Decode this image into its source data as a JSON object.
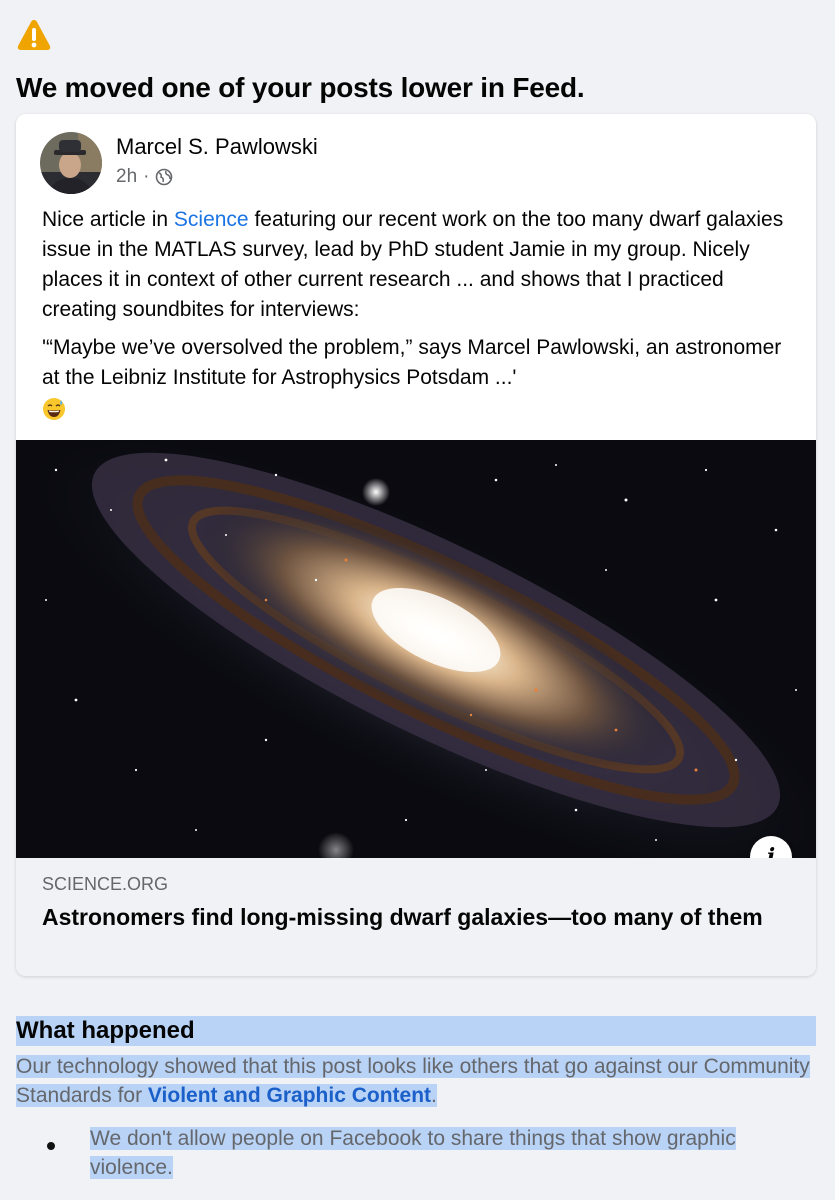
{
  "notice": {
    "icon": "warning-triangle-icon",
    "icon_color": "#f0a400",
    "headline": "We moved one of your posts lower in Feed."
  },
  "post": {
    "author": "Marcel S. Pawlowski",
    "time": "2h",
    "separator": "·",
    "audience_icon": "globe-icon",
    "text_before_link": "Nice article in ",
    "text_link": "Science",
    "text_after_link": " featuring our recent work on the too many dwarf galaxies issue in the MATLAS survey, lead by PhD student Jamie in my group. Nicely places it in context of other current research ... and shows that I practiced creating soundbites for interviews:",
    "quote": "'“Maybe we’ve oversolved the problem,” says Marcel Pawlowski, an astronomer at the Leibniz Institute for Astrophysics Potsdam ...'",
    "emoji": "grinning-sweat-emoji"
  },
  "link_preview": {
    "image": "andromeda-galaxy-photo",
    "info_label": "i",
    "domain": "SCIENCE.ORG",
    "title": "Astronomers find long-missing dwarf galaxies—too many of them"
  },
  "what_happened": {
    "title": "What happened",
    "body_before": "Our technology showed that this post looks like others that go against our Community Standards for ",
    "body_link": "Violent and Graphic Content",
    "body_after": ".",
    "bullet": "We don't allow people on Facebook to share things that show graphic violence."
  },
  "colors": {
    "link_blue": "#1b74e4",
    "highlight": "#b9d3f7",
    "secondary_text": "#65676b",
    "background": "#f0f2f5"
  }
}
